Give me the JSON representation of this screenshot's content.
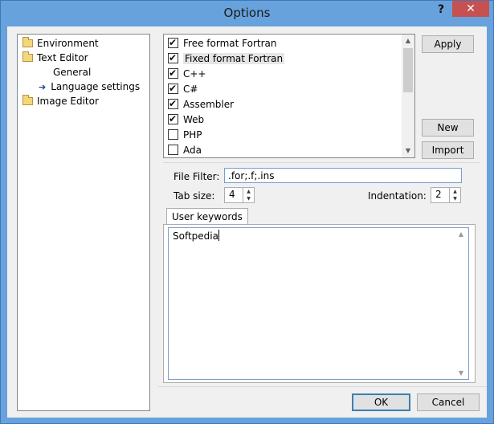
{
  "window": {
    "title": "Options",
    "help_label": "?",
    "close_label": "✕"
  },
  "tree": {
    "items": [
      {
        "label": "Environment",
        "icon": "folder-icon"
      },
      {
        "label": "Text Editor",
        "icon": "folder-icon"
      },
      {
        "label": "General",
        "icon": "none"
      },
      {
        "label": "Language settings",
        "icon": "arrow-icon"
      },
      {
        "label": "Image Editor",
        "icon": "folder-icon"
      }
    ]
  },
  "languages": [
    {
      "label": "Free format Fortran",
      "checked": true
    },
    {
      "label": "Fixed format Fortran",
      "checked": true,
      "selected": true
    },
    {
      "label": "C++",
      "checked": true
    },
    {
      "label": "C#",
      "checked": true
    },
    {
      "label": "Assembler",
      "checked": true
    },
    {
      "label": "Web",
      "checked": true
    },
    {
      "label": "PHP",
      "checked": false
    },
    {
      "label": "Ada",
      "checked": false
    }
  ],
  "buttons": {
    "apply": "Apply",
    "new": "New",
    "import": "Import",
    "ok": "OK",
    "cancel": "Cancel"
  },
  "settings": {
    "file_filter_label": "File Filter:",
    "file_filter_value": ".for;.f;.ins",
    "tab_size_label": "Tab size:",
    "tab_size_value": "4",
    "indentation_label": "Indentation:",
    "indentation_value": "2"
  },
  "keywords": {
    "tab_label": "User keywords",
    "text": "Softpedia"
  },
  "colors": {
    "title_bar": "#67a2dc",
    "close_button": "#c75050"
  }
}
